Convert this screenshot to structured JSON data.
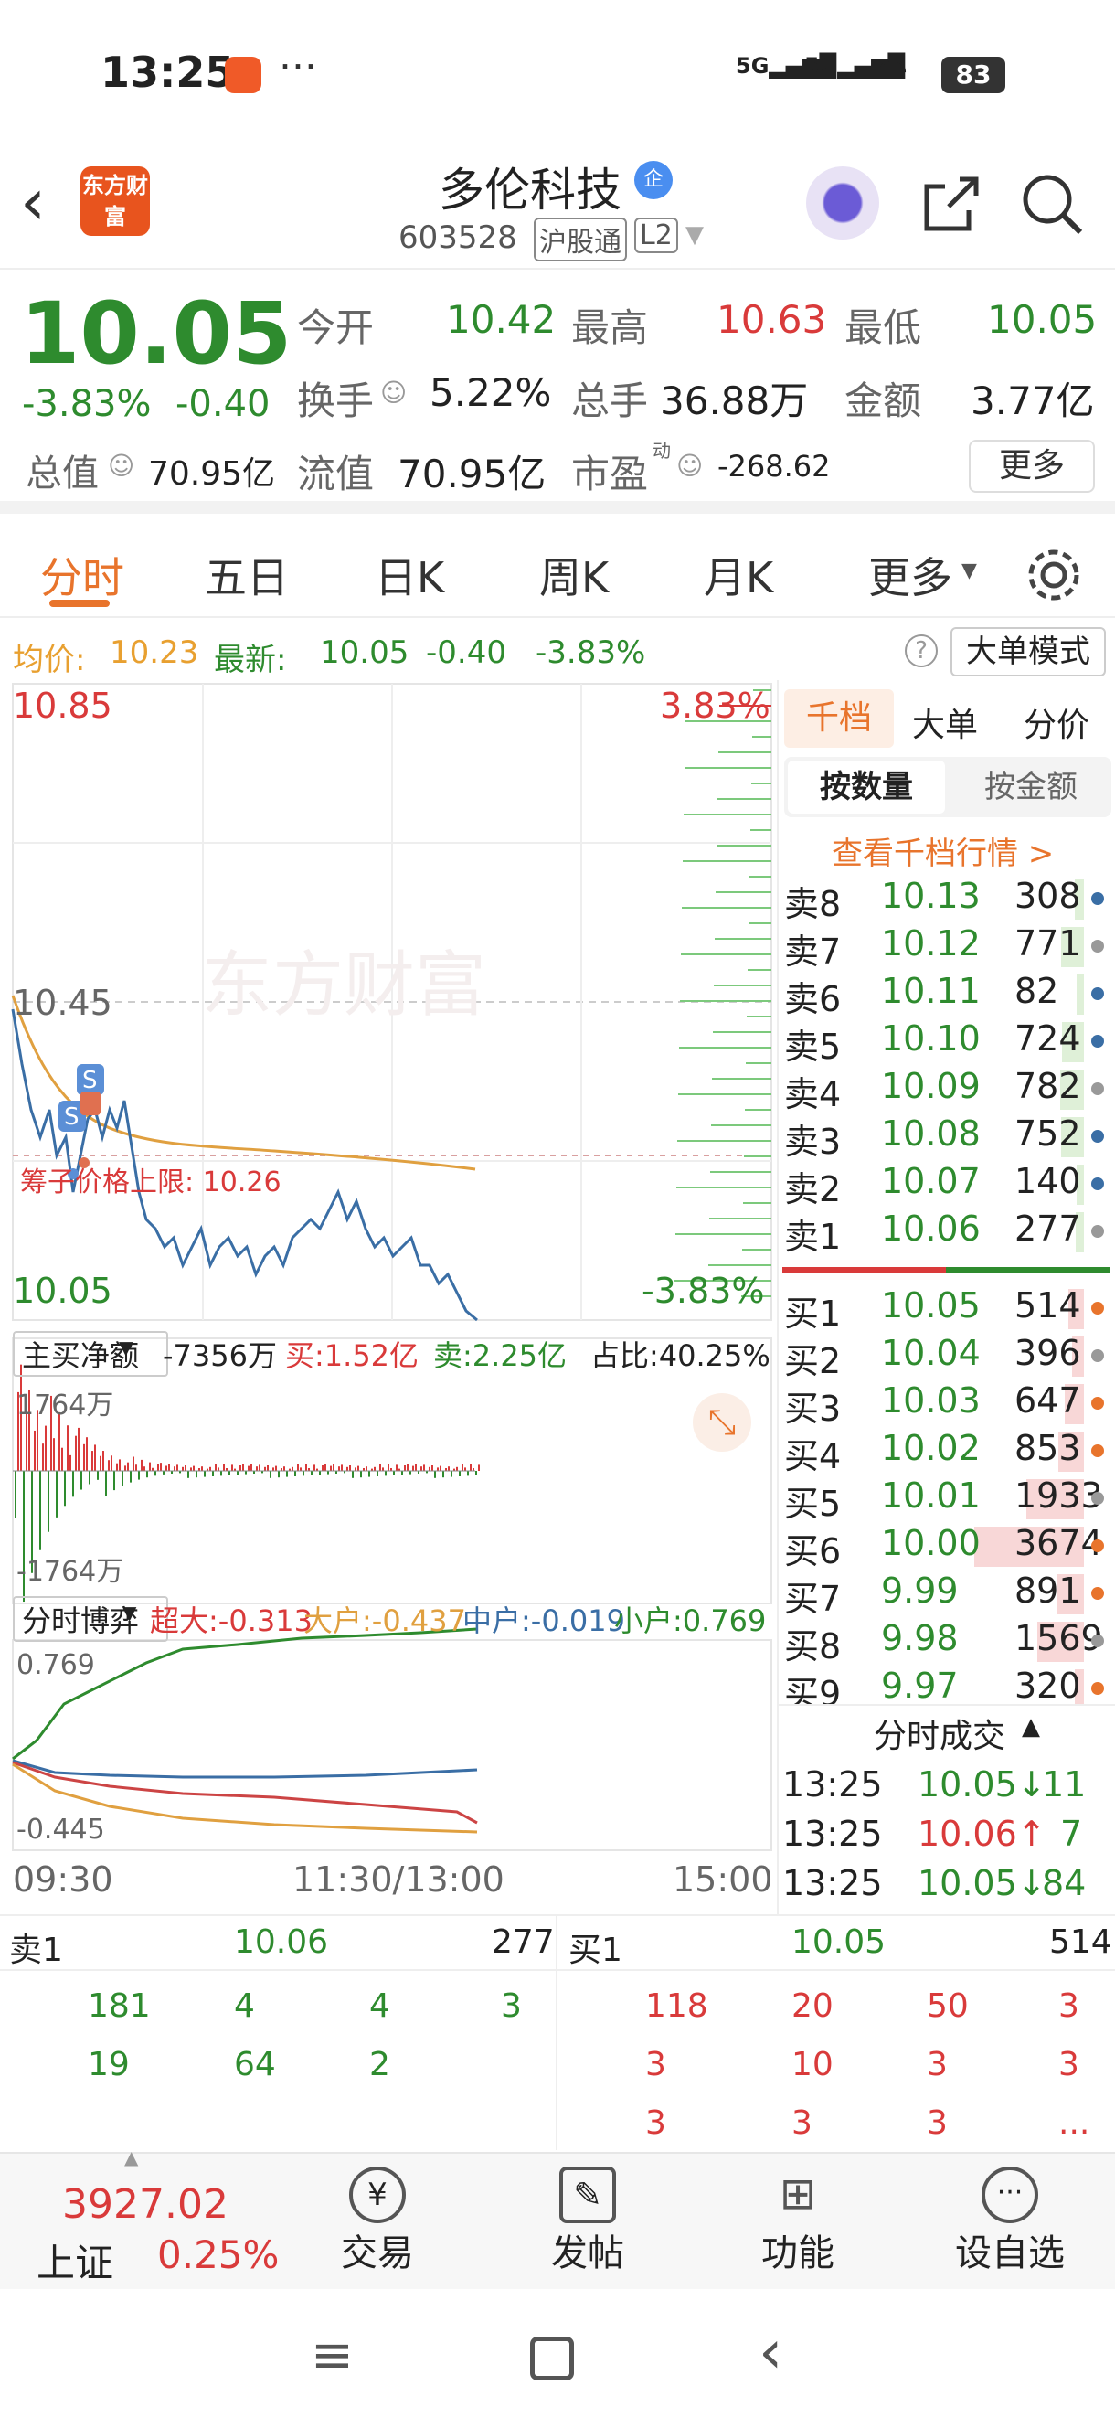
{
  "status": {
    "time": "13:25",
    "battery": "83",
    "dots": "···"
  },
  "header": {
    "name": "多伦科技",
    "badge": "企",
    "code": "603528",
    "tag1": "沪股通",
    "tag2": "L2",
    "logo": "东方财富"
  },
  "quote": {
    "price": "10.05",
    "pct": "-3.83%",
    "chg": "-0.40",
    "f1l": "今开",
    "f1v": "10.42",
    "f2l": "最高",
    "f2v": "10.63",
    "f3l": "最低",
    "f3v": "10.05",
    "f4l": "换手",
    "f4v": "5.22%",
    "f5l": "总手",
    "f5v": "36.88万",
    "f6l": "金额",
    "f6v": "3.77亿",
    "f7l": "总值",
    "f7v": "70.95亿",
    "f8l": "流值",
    "f8v": "70.95亿",
    "f9l": "市盈",
    "f9sup": "动",
    "f9v": "-268.62",
    "more": "更多"
  },
  "tabs": [
    "分时",
    "五日",
    "日K",
    "周K",
    "月K",
    "更多"
  ],
  "avg": {
    "l1": "均价:",
    "v1": "10.23",
    "l2": "最新:",
    "v2": "10.05",
    "v3": "-0.40",
    "v4": "-3.83%",
    "mode": "大单模式"
  },
  "chart_labels": {
    "top": "10.85",
    "mid": "10.45",
    "bottom": "10.05",
    "topPct": "3.83%",
    "botPct": "-3.83%",
    "limit": "筹子价格上限:  10.26",
    "watermark": "东方财富"
  },
  "flow": {
    "name": "主买净额",
    "net": "-7356万",
    "buy": "买:1.52亿",
    "sell": "卖:2.25亿",
    "ratio": "占比:40.25%",
    "top": "1764万",
    "bot": "-1764万"
  },
  "game": {
    "name": "分时博弈",
    "s1": "超大:-0.313",
    "s2": "大户:-0.437",
    "s3": "中户:-0.019",
    "s4": "小户:0.769",
    "top": "0.769",
    "bot": "-0.445"
  },
  "time_axis": {
    "t1": "09:30",
    "t2": "11:30/13:00",
    "t3": "15:00"
  },
  "panel": {
    "tabs": [
      "千档",
      "大单",
      "分价"
    ],
    "sub": [
      "按数量",
      "按金额"
    ],
    "link": "查看千档行情 >",
    "asks": [
      [
        "卖8",
        "10.13",
        "308"
      ],
      [
        "卖7",
        "10.12",
        "771"
      ],
      [
        "卖6",
        "10.11",
        "82"
      ],
      [
        "卖5",
        "10.10",
        "724"
      ],
      [
        "卖4",
        "10.09",
        "782"
      ],
      [
        "卖3",
        "10.08",
        "752"
      ],
      [
        "卖2",
        "10.07",
        "140"
      ],
      [
        "卖1",
        "10.06",
        "277"
      ]
    ],
    "bids": [
      [
        "买1",
        "10.05",
        "514"
      ],
      [
        "买2",
        "10.04",
        "396"
      ],
      [
        "买3",
        "10.03",
        "647"
      ],
      [
        "买4",
        "10.02",
        "853"
      ],
      [
        "买5",
        "10.01",
        "1933"
      ],
      [
        "买6",
        "10.00",
        "3674"
      ],
      [
        "买7",
        "9.99",
        "891"
      ],
      [
        "买8",
        "9.98",
        "1569"
      ],
      [
        "买9",
        "9.97",
        "320"
      ]
    ],
    "trades_title": "分时成交",
    "trades": [
      [
        "13:25",
        "10.05↓",
        "11"
      ],
      [
        "13:25",
        "10.06↑",
        "7"
      ],
      [
        "13:25",
        "10.05↓",
        "84"
      ]
    ]
  },
  "queue": {
    "sellLabel": "卖1",
    "sellPrice": "10.06",
    "sellVol": "277",
    "buyLabel": "买1",
    "buyPrice": "10.05",
    "buyVol": "514",
    "sellRows": [
      [
        "181",
        "4",
        "4",
        "3"
      ],
      [
        "19",
        "64",
        "2",
        ""
      ]
    ],
    "buyRows": [
      [
        "118",
        "20",
        "50",
        "3"
      ],
      [
        "3",
        "10",
        "3",
        "3"
      ],
      [
        "3",
        "3",
        "3",
        "..."
      ]
    ]
  },
  "bottom": {
    "index": "3927.02",
    "indexName": "上证",
    "indexPct": "0.25%",
    "b1": "交易",
    "b2": "发帖",
    "b3": "功能",
    "b4": "设自选"
  },
  "colors": {
    "up": "#d93a3a",
    "down": "#2e8b2e",
    "accent": "#e8742c",
    "price_line": "#3a6ea5",
    "avg_line": "#e0a040"
  }
}
